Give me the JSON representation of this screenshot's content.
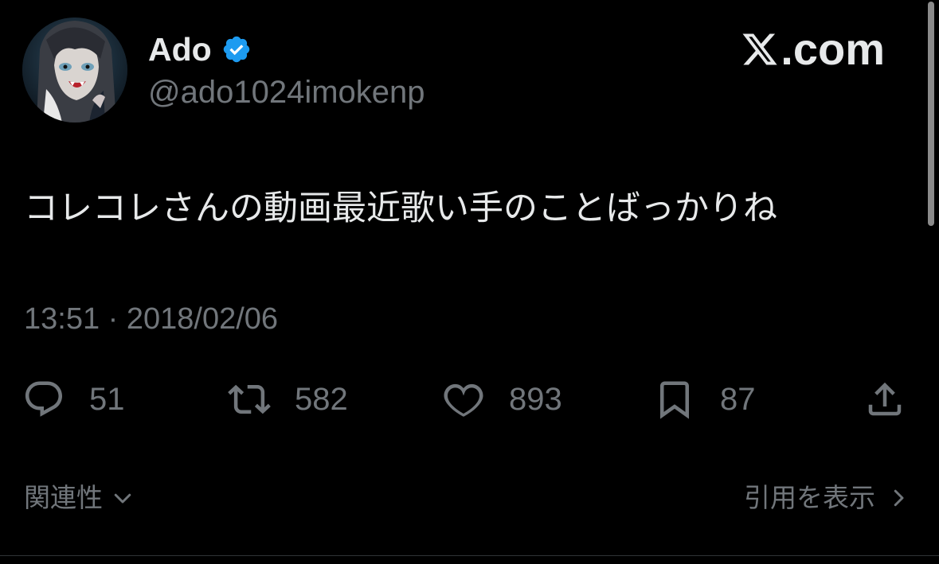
{
  "author": {
    "display_name": "Ado",
    "handle": "@ado1024imokenp",
    "verified_icon": "verified-badge-icon",
    "avatar": "user-avatar"
  },
  "brand": {
    "site": ".com",
    "logo_icon": "x-logo-icon"
  },
  "tweet": {
    "text": "コレコレさんの動画最近歌い手のことばっかりね",
    "timestamp": "13:51 · 2018/02/06"
  },
  "actions": {
    "reply": {
      "icon": "reply-icon",
      "count": "51"
    },
    "retweet": {
      "icon": "retweet-icon",
      "count": "582"
    },
    "like": {
      "icon": "heart-icon",
      "count": "893"
    },
    "bookmark": {
      "icon": "bookmark-icon",
      "count": "87"
    },
    "share": {
      "icon": "share-icon"
    }
  },
  "footer": {
    "related_label": "関連性",
    "quotes_label": "引用を表示"
  },
  "colors": {
    "background": "#000000",
    "text_primary": "#e7e9ea",
    "text_secondary": "#71767b",
    "verified_blue": "#1d9bf0"
  }
}
